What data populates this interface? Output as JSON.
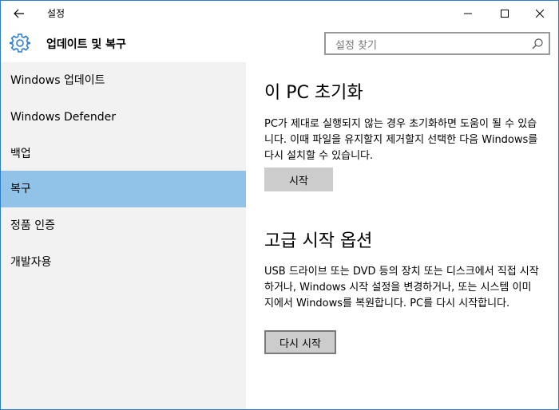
{
  "window": {
    "title": "설정",
    "back_icon": "arrow-left-icon",
    "minimize_icon": "minimize-icon",
    "maximize_icon": "maximize-icon",
    "close_icon": "close-icon",
    "accent": "#2b7cd3"
  },
  "header": {
    "icon": "gear-icon",
    "title": "업데이트 및 복구",
    "search": {
      "placeholder": "설정 찾기",
      "icon": "search-icon"
    }
  },
  "sidebar": {
    "items": [
      {
        "label": "Windows 업데이트",
        "active": false
      },
      {
        "label": "Windows Defender",
        "active": false
      },
      {
        "label": "백업",
        "active": false
      },
      {
        "label": "복구",
        "active": true
      },
      {
        "label": "정품 인증",
        "active": false
      },
      {
        "label": "개발자용",
        "active": false
      }
    ],
    "active_color": "#91c3e8",
    "background": "#f2f2f2"
  },
  "main": {
    "reset": {
      "title": "이 PC 초기화",
      "description": "PC가 제대로 실행되지 않는 경우 초기화하면 도움이 될 수 있습니다. 이때 파일을 유지할지 제거할지 선택한 다음 Windows를 다시 설치할 수 있습니다.",
      "button_label": "시작"
    },
    "advanced": {
      "title": "고급 시작 옵션",
      "description": "USB 드라이브 또는 DVD 등의 장치 또는 디스크에서 직접 시작하거나, Windows 시작 설정을 변경하거나, 또는 시스템 이미지에서 Windows를 복원합니다. PC를 다시 시작합니다.",
      "button_label": "다시 시작"
    }
  }
}
